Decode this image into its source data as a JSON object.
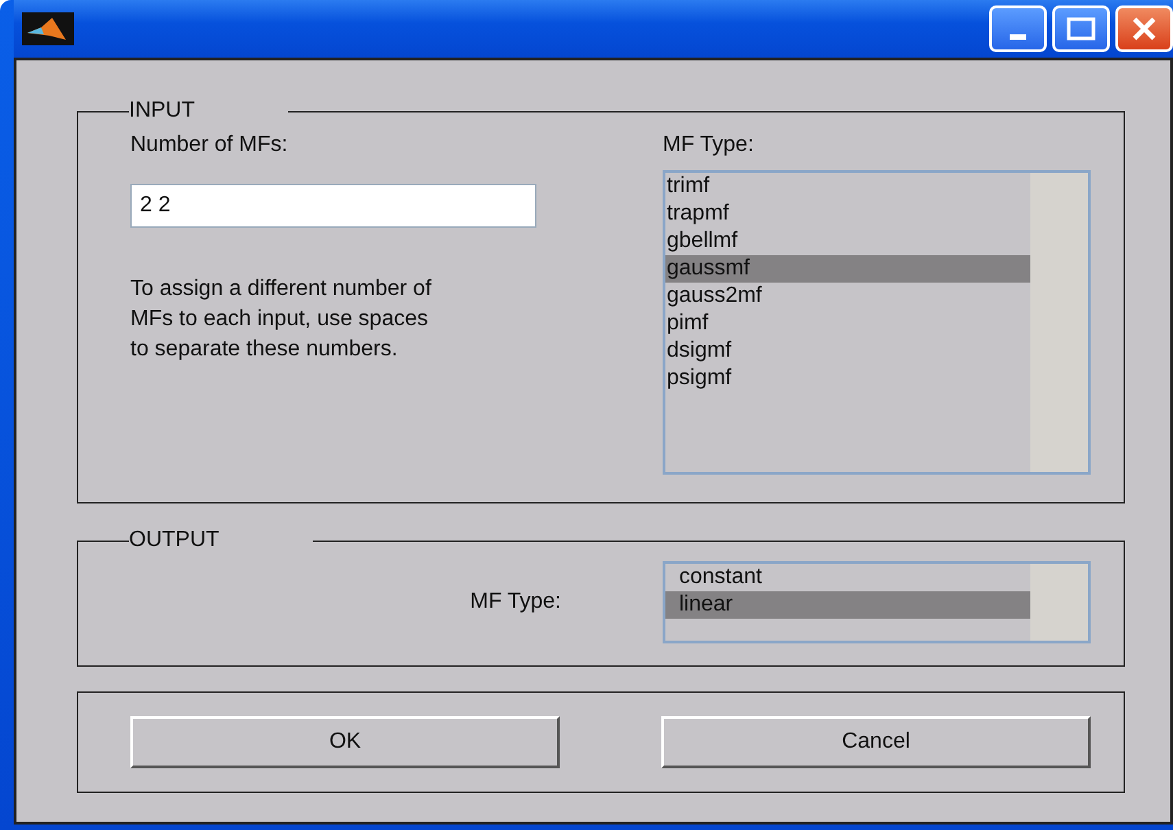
{
  "input": {
    "legend": "INPUT",
    "count_label": "Number of MFs:",
    "count_value": "2 2",
    "hint": "To assign a different number of MFs to each input, use spaces to separate these numbers.",
    "type_label": "MF Type:",
    "types": [
      {
        "label": "trimf",
        "selected": false
      },
      {
        "label": "trapmf",
        "selected": false
      },
      {
        "label": "gbellmf",
        "selected": false
      },
      {
        "label": "gaussmf",
        "selected": true
      },
      {
        "label": "gauss2mf",
        "selected": false
      },
      {
        "label": "pimf",
        "selected": false
      },
      {
        "label": "dsigmf",
        "selected": false
      },
      {
        "label": "psigmf",
        "selected": false
      }
    ]
  },
  "output": {
    "legend": "OUTPUT",
    "type_label": "MF Type:",
    "types": [
      {
        "label": "constant",
        "selected": false
      },
      {
        "label": "linear",
        "selected": true
      }
    ]
  },
  "buttons": [
    "OK",
    "Cancel"
  ]
}
